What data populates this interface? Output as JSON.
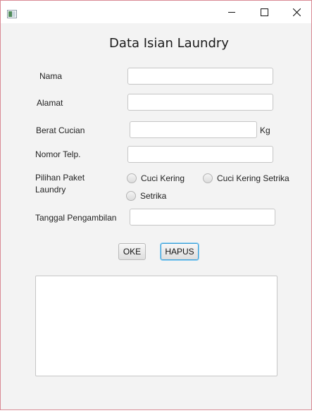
{
  "window": {
    "controls": {
      "minimize_icon": "minimize-icon",
      "maximize_icon": "maximize-icon",
      "close_icon": "close-icon"
    }
  },
  "form": {
    "title": "Data Isian Laundry",
    "fields": {
      "nama": {
        "label": "Nama",
        "value": ""
      },
      "alamat": {
        "label": "Alamat",
        "value": ""
      },
      "berat": {
        "label": "Berat Cucian",
        "value": "",
        "unit": "Kg"
      },
      "telp": {
        "label": "Nomor Telp.",
        "value": ""
      },
      "tanggal": {
        "label": "Tanggal Pengambilan",
        "value": ""
      }
    },
    "paket": {
      "label": "Pilihan Paket Laundry",
      "options": [
        "Cuci Kering",
        "Cuci Kering Setrika",
        "Setrika"
      ],
      "selected": null
    },
    "buttons": {
      "ok": "OKE",
      "hapus": "HAPUS"
    },
    "output": ""
  },
  "colors": {
    "focus_border": "#3ea0d8",
    "window_border": "#d98a94",
    "background": "#f3f3f3"
  }
}
